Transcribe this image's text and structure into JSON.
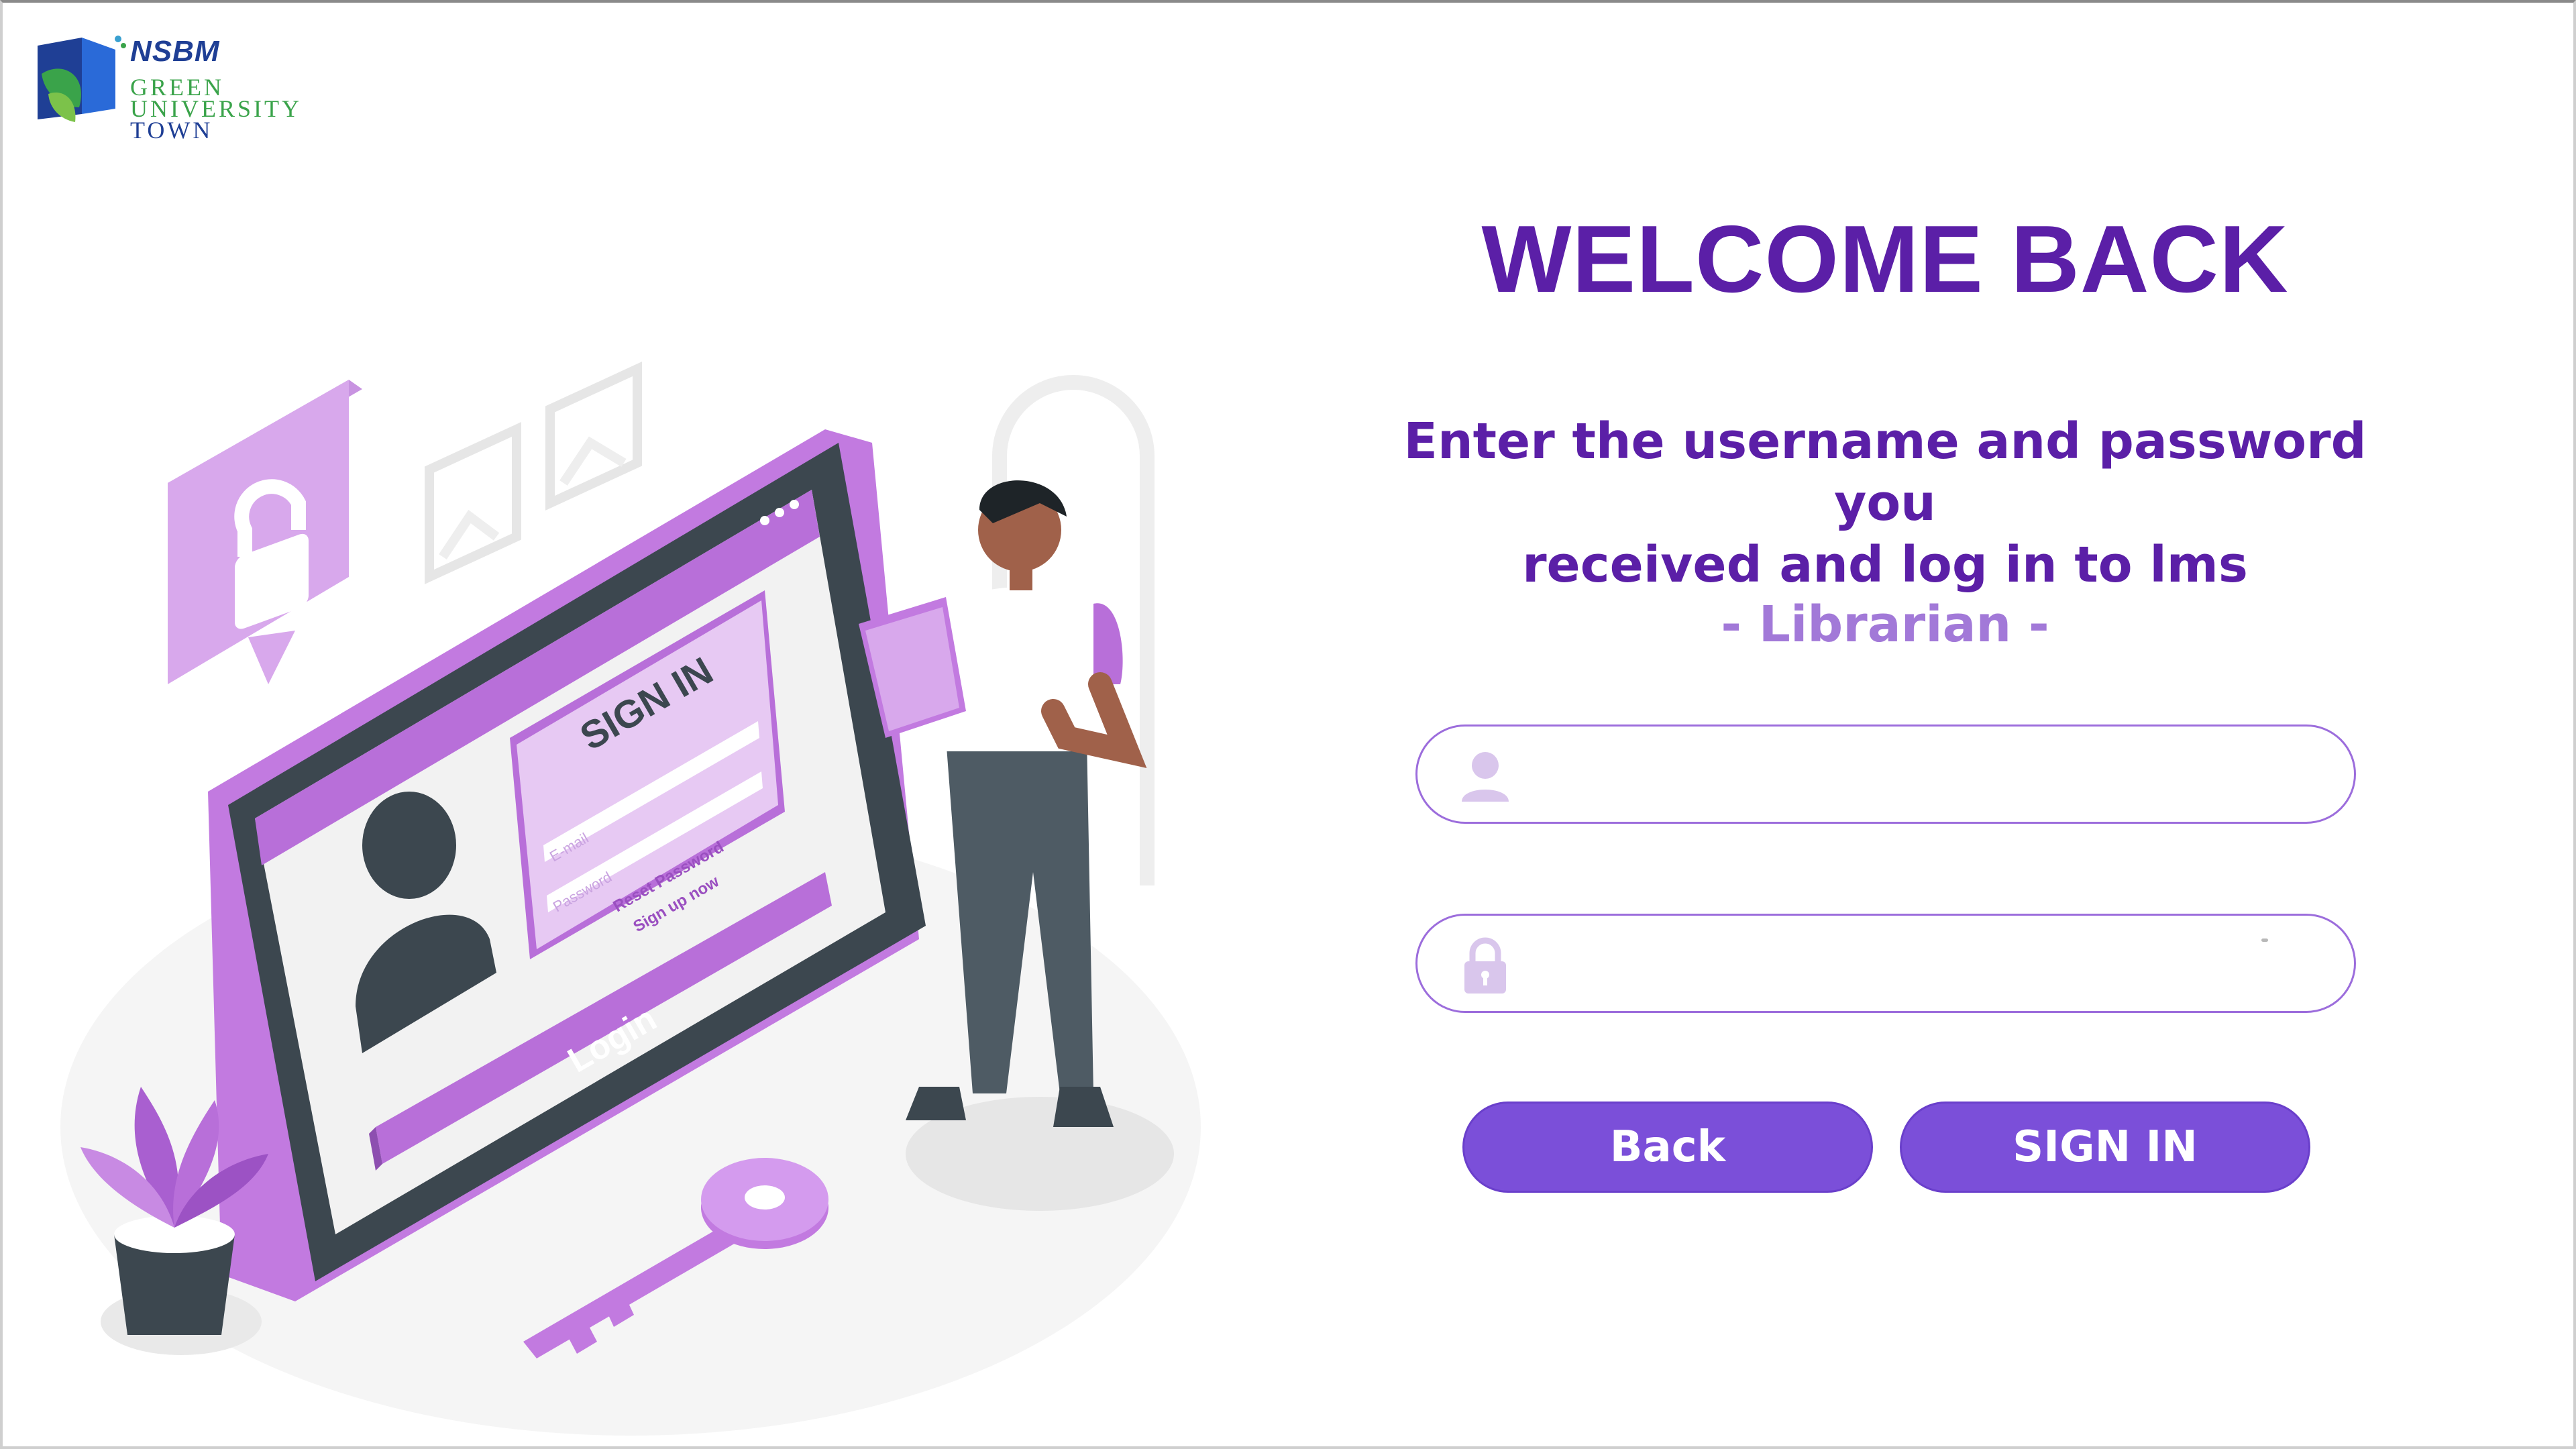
{
  "logo": {
    "brand": "NSBM",
    "line1": "GREEN",
    "line2": "UNIVERSITY",
    "line3": "TOWN"
  },
  "illustration": {
    "screen_title": "SIGN IN",
    "email_placeholder": "E-mail",
    "password_placeholder": "Password",
    "reset_link": "Reset Password",
    "signup_link": "Sign up now",
    "login_label": "Login"
  },
  "main": {
    "title": "WELCOME BACK",
    "subtitle_line1": "Enter the username and password you",
    "subtitle_line2": "received and log in to lms",
    "role": "- Librarian -"
  },
  "form": {
    "username": {
      "value": "",
      "icon": "user-icon"
    },
    "password": {
      "value": "",
      "icon": "lock-icon"
    }
  },
  "buttons": {
    "back_label": "Back",
    "signin_label": "SIGN IN"
  },
  "colors": {
    "primary_purple": "#5b1fa7",
    "button_purple": "#7b4fd9",
    "role_lavender": "#a279d8",
    "illustration_purple": "#b86fd9",
    "logo_blue": "#1f3f95",
    "logo_green": "#3aa34a"
  }
}
